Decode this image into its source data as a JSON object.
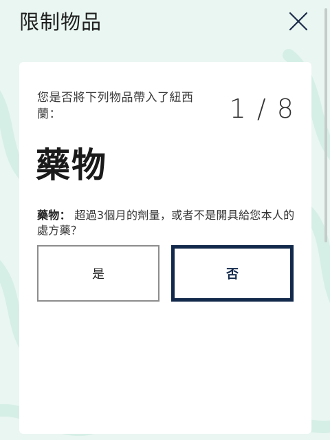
{
  "header": {
    "title": "限制物品",
    "close_icon": "close-icon"
  },
  "card": {
    "question": "您是否將下列物品帶入了紐西蘭：",
    "counter": "1 / 8",
    "item_heading": "藥物",
    "description_label": "藥物：",
    "description_text": "超過3個月的劑量，或者不是開具給您本人的處方藥？",
    "yes_label": "是",
    "no_label": "否"
  },
  "colors": {
    "background": "#e9f6f1",
    "selected_border": "#13294b",
    "default_border": "#8c8c8c"
  }
}
